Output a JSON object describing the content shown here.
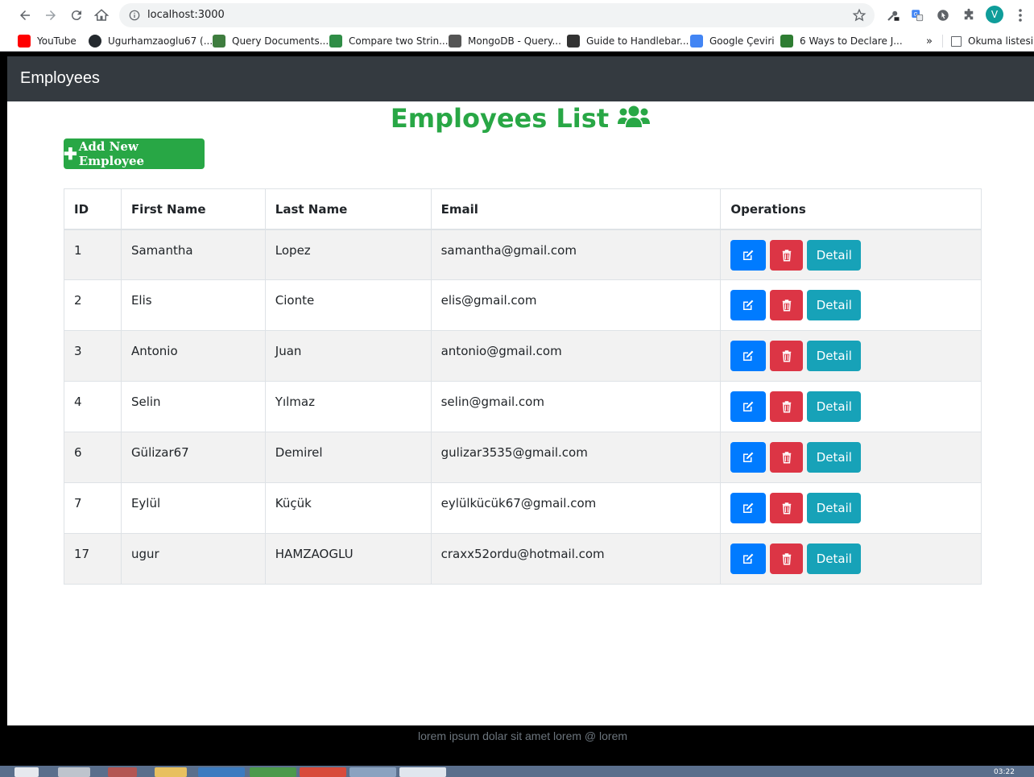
{
  "browser": {
    "url": "localhost:3000",
    "avatar_letter": "V",
    "bookmarks": [
      {
        "label": "YouTube",
        "color": "#ff0000"
      },
      {
        "label": "Ugurhamzaoglu67 (...",
        "color": "#24292e"
      },
      {
        "label": "Query Documents...",
        "color": "#3f7d3f"
      },
      {
        "label": "Compare two Strin...",
        "color": "#2f8d46"
      },
      {
        "label": "MongoDB - Query...",
        "color": "#555555"
      },
      {
        "label": "Guide to Handlebar...",
        "color": "#333333"
      },
      {
        "label": "Google Çeviri",
        "color": "#4285f4"
      },
      {
        "label": "6 Ways to Declare J...",
        "color": "#2e7d32"
      }
    ],
    "overflow": "»",
    "reading_list": "Okuma listesi"
  },
  "navbar": {
    "brand": "Employees"
  },
  "main": {
    "title": "Employees List",
    "add_button": "Add New Employee",
    "table": {
      "headers": [
        "ID",
        "First Name",
        "Last Name",
        "Email",
        "Operations"
      ],
      "detail_label": "Detail",
      "rows": [
        {
          "id": "1",
          "first": "Samantha",
          "last": "Lopez",
          "email": "samantha@gmail.com"
        },
        {
          "id": "2",
          "first": "Elis",
          "last": "Cionte",
          "email": "elis@gmail.com"
        },
        {
          "id": "3",
          "first": "Antonio",
          "last": "Juan",
          "email": "antonio@gmail.com"
        },
        {
          "id": "4",
          "first": "Selin",
          "last": "Yılmaz",
          "email": "selin@gmail.com"
        },
        {
          "id": "6",
          "first": "Gülizar67",
          "last": "Demirel",
          "email": "gulizar3535@gmail.com"
        },
        {
          "id": "7",
          "first": "Eylül",
          "last": "Küçük",
          "email": "eylülkücük67@gmail.com"
        },
        {
          "id": "17",
          "first": "ugur",
          "last": "HAMZAOGLU",
          "email": "craxx52ordu@hotmail.com"
        }
      ]
    }
  },
  "footer": {
    "text": "lorem ipsum dolar sit amet lorem @ lorem"
  },
  "taskbar": {
    "clock": "03:22"
  },
  "colors": {
    "navbar": "#343a40",
    "success": "#28a745",
    "primary": "#007bff",
    "danger": "#dc3545",
    "info": "#17a2b8"
  }
}
